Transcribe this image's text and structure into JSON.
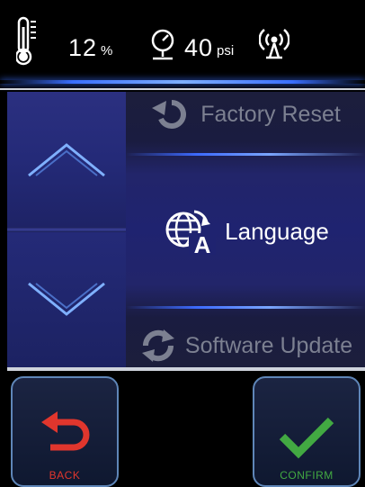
{
  "status": {
    "humidity_value": "12",
    "humidity_unit": "%",
    "pressure_value": "40",
    "pressure_unit": "psi",
    "icons": [
      "thermometer-icon",
      "pressure-gauge-icon",
      "wireless-signal-icon"
    ]
  },
  "menu": {
    "previous_label": "Factory Reset",
    "current_label": "Language",
    "next_label": "Software Update"
  },
  "buttons": {
    "back_label": "BACK",
    "confirm_label": "CONFIRM"
  },
  "colors": {
    "back": "#e0362d",
    "confirm": "#42a942",
    "accent": "#3a6fff"
  }
}
